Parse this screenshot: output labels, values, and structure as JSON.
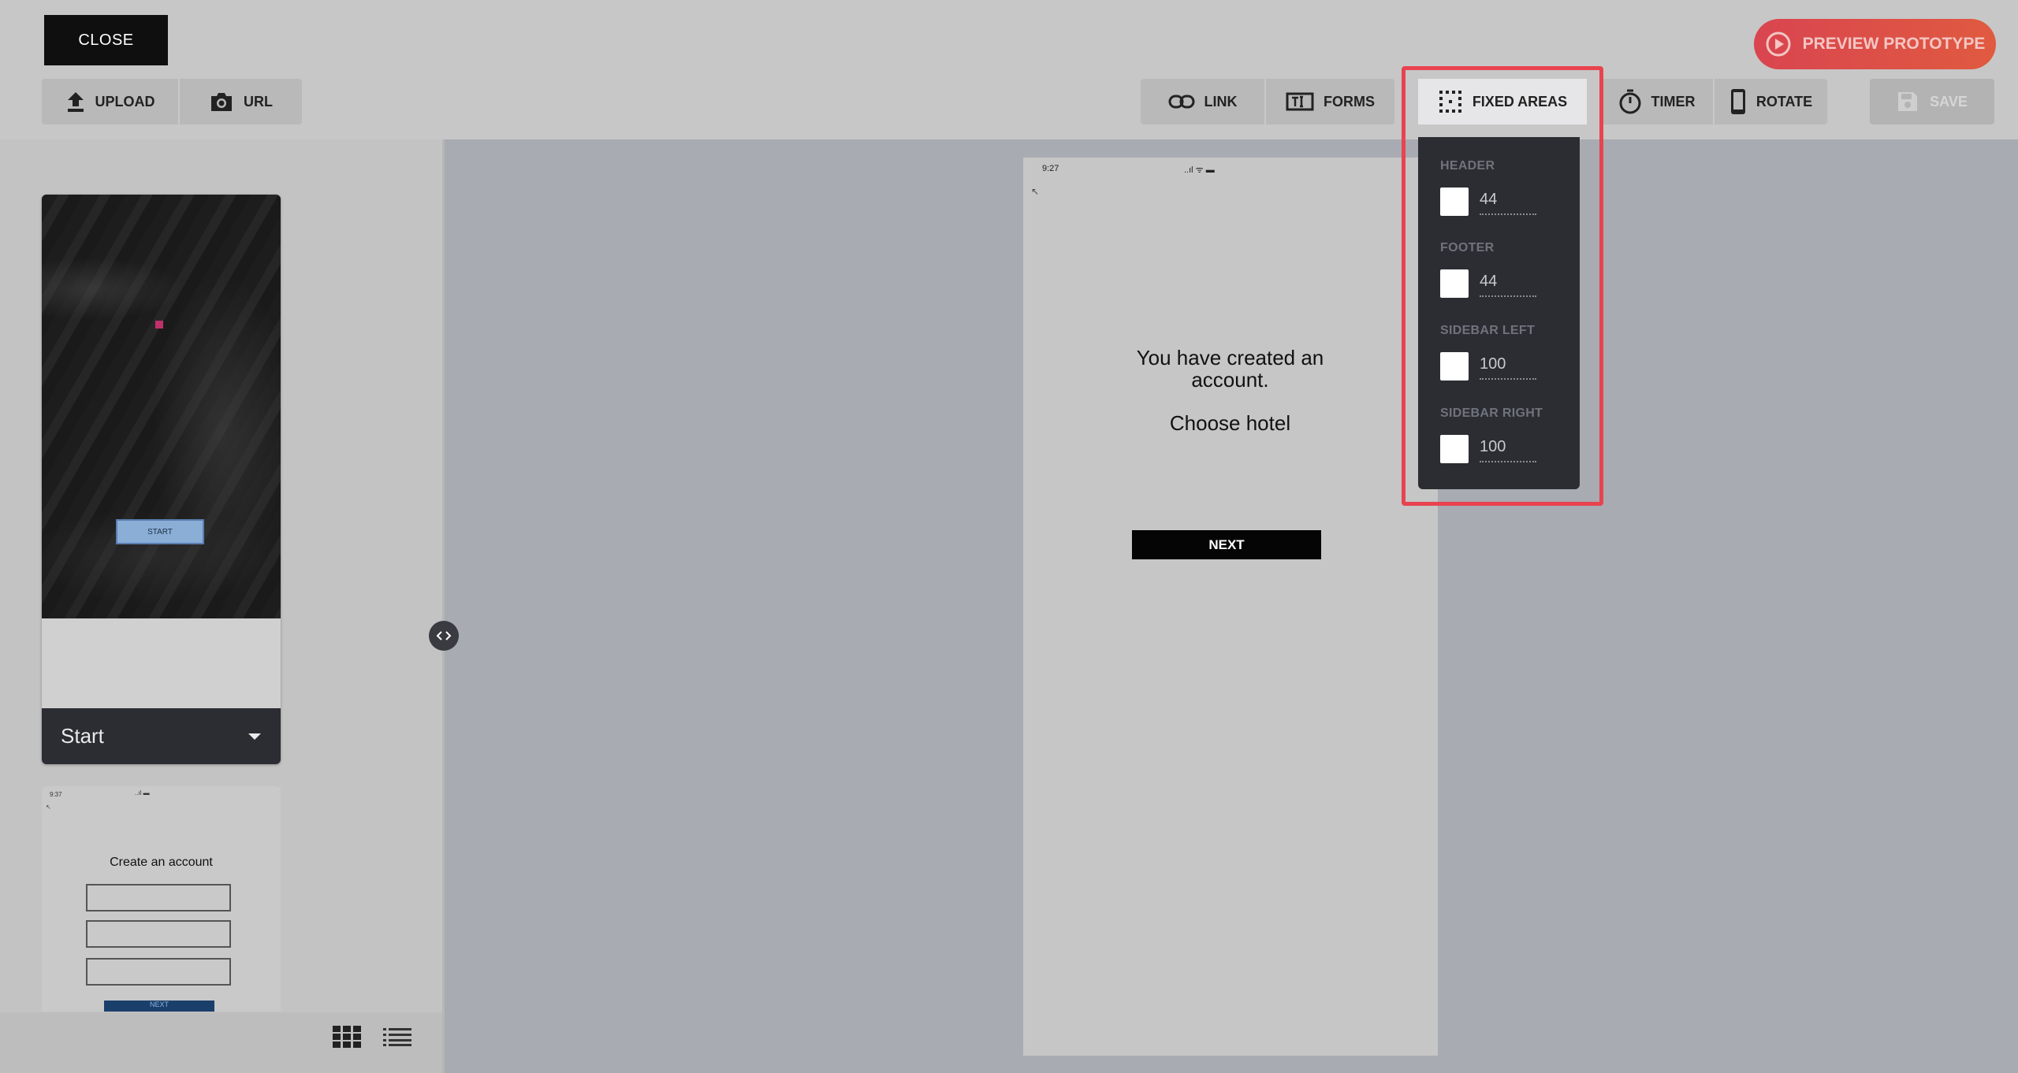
{
  "topbar": {
    "close_label": "CLOSE",
    "upload_label": "UPLOAD",
    "url_label": "URL",
    "link_label": "LINK",
    "forms_label": "FORMS",
    "fixed_areas_label": "FIXED AREAS",
    "timer_label": "TIMER",
    "rotate_label": "ROTATE",
    "save_label": "SAVE",
    "preview_label": "PREVIEW PROTOTYPE",
    "accent_color": "#e04a4a"
  },
  "sidebar": {
    "screens": [
      {
        "start_button_label": "START",
        "selected_name": "Start"
      },
      {
        "status_time": "9:37",
        "title": "Create an account",
        "next_label": "NEXT"
      }
    ]
  },
  "phone": {
    "status_time": "9:27",
    "status_icons": "..ıl ᯤ ▬",
    "back_glyph": "↖",
    "message": "You have created an account.",
    "choose": "Choose hotel",
    "next_label": "NEXT"
  },
  "fixed_areas": {
    "items": [
      {
        "label": "HEADER",
        "value": "44",
        "checked": false
      },
      {
        "label": "FOOTER",
        "value": "44",
        "checked": false
      },
      {
        "label": "SIDEBAR LEFT",
        "value": "100",
        "checked": false
      },
      {
        "label": "SIDEBAR RIGHT",
        "value": "100",
        "checked": false
      }
    ]
  }
}
